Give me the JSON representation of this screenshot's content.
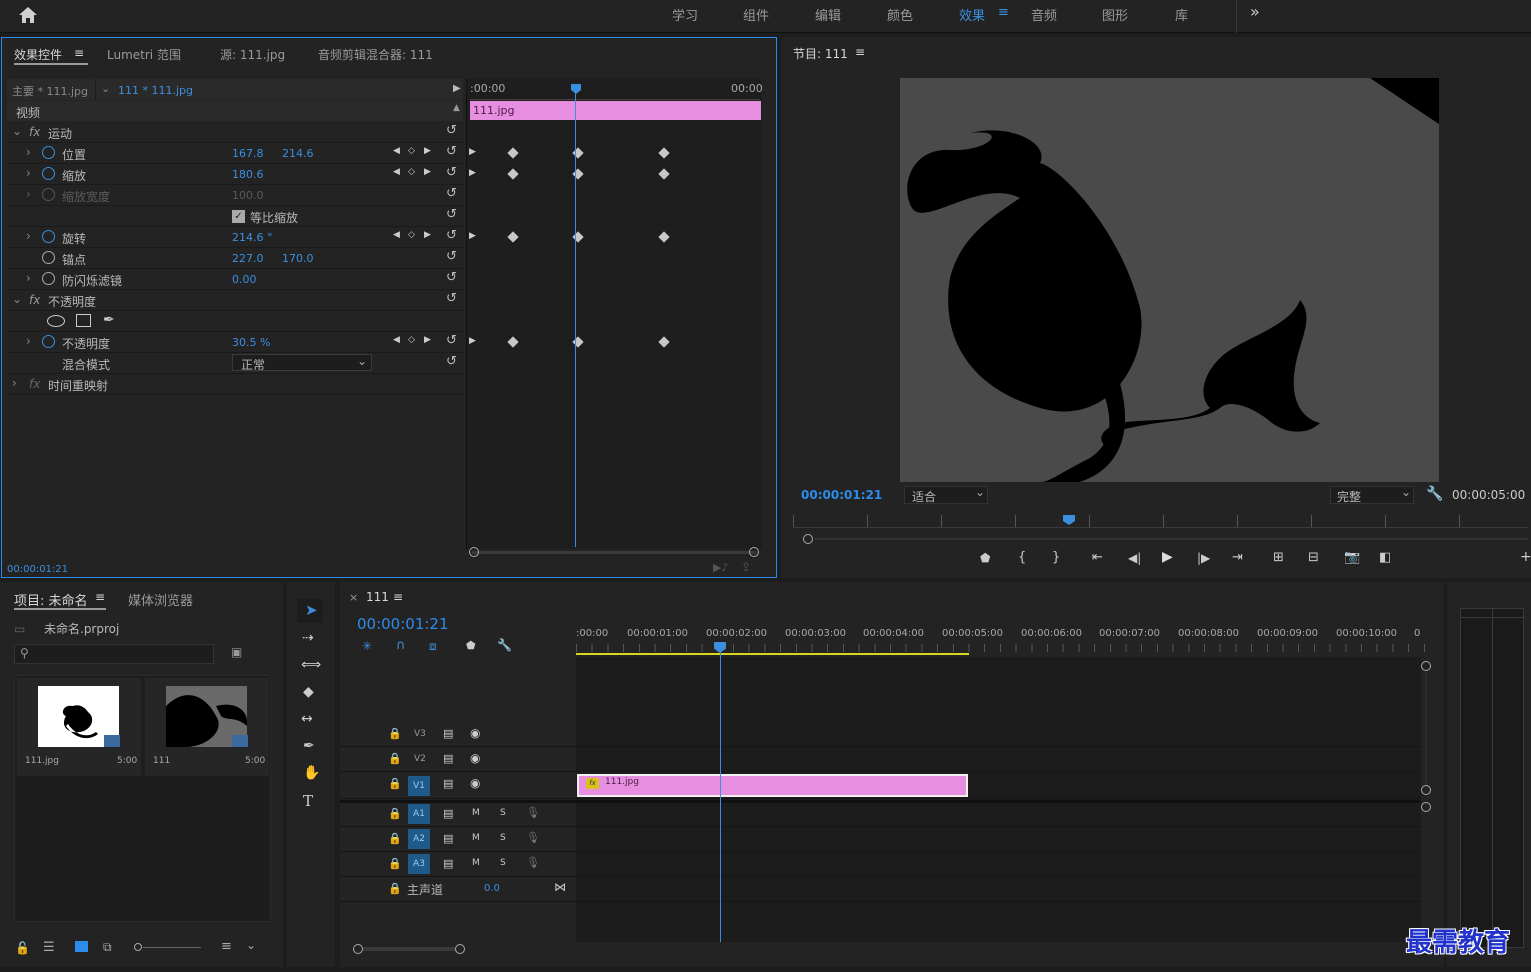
{
  "workspaces": {
    "home": "home-icon",
    "tabs": [
      "学习",
      "组件",
      "编辑",
      "颜色",
      "效果",
      "音频",
      "图形",
      "库"
    ],
    "active": "效果",
    "more": "»"
  },
  "effect_controls": {
    "tabs": [
      "效果控件",
      "Lumetri 范围",
      "源: 111.jpg",
      "音频剪辑混合器: 111"
    ],
    "menu_icon": "≡",
    "master": "主要 * 111.jpg",
    "clip": "111 * 111.jpg",
    "ruler_start": ":00:00",
    "ruler_end": "00:00",
    "clip_bar": "111.jpg",
    "video_header": "视频",
    "motion": "运动",
    "position": {
      "label": "位置",
      "x": "167.8",
      "y": "214.6"
    },
    "scale": {
      "label": "缩放",
      "value": "180.6"
    },
    "scale_width": {
      "label": "缩放宽度",
      "value": "100.0"
    },
    "uniform": "等比缩放",
    "rotation": {
      "label": "旋转",
      "value": "214.6 °"
    },
    "anchor": {
      "label": "锚点",
      "x": "227.0",
      "y": "170.0"
    },
    "flicker": {
      "label": "防闪烁滤镜",
      "value": "0.00"
    },
    "opacity_group": "不透明度",
    "opacity": {
      "label": "不透明度",
      "value": "30.5 %"
    },
    "blend": {
      "label": "混合模式",
      "value": "正常"
    },
    "time_remap": "时间重映射",
    "timecode": "00:00:01:21",
    "fx": "fx"
  },
  "program": {
    "title": "节目: 111",
    "menu_icon": "≡",
    "timecode": "00:00:01:21",
    "fit": "适合",
    "quality": "完整",
    "duration": "00:00:05:00"
  },
  "project": {
    "tabs": [
      "项目: 未命名",
      "媒体浏览器"
    ],
    "menu_icon": "≡",
    "file": "未命名.prproj",
    "items": [
      {
        "name": "111.jpg",
        "dur": "5:00"
      },
      {
        "name": "111",
        "dur": "5:00"
      }
    ]
  },
  "timeline": {
    "close": "×",
    "title": "111",
    "menu_icon": "≡",
    "timecode": "00:00:01:21",
    "ruler": [
      ":00:00",
      "00:00:01:00",
      "00:00:02:00",
      "00:00:03:00",
      "00:00:04:00",
      "00:00:05:00",
      "00:00:06:00",
      "00:00:07:00",
      "00:00:08:00",
      "00:00:09:00",
      "00:00:10:00",
      "0"
    ],
    "video_tracks": [
      "V3",
      "V2",
      "V1"
    ],
    "audio_tracks": [
      "A1",
      "A2",
      "A3"
    ],
    "m": "M",
    "s": "S",
    "master": "主声道",
    "master_val": "0.0",
    "clip": "111.jpg"
  },
  "watermark": "最需教育",
  "colors": {
    "accent": "#2d8ceb",
    "clip": "#e88ee0",
    "track_btn": "#1e5a8a",
    "work_area": "#d8d81e"
  }
}
